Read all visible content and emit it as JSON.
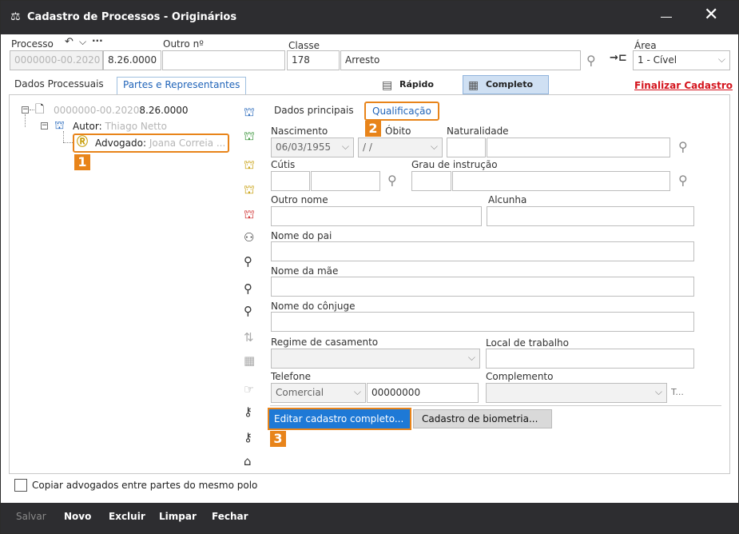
{
  "window": {
    "title": "Cadastro de Processos - Originários"
  },
  "header": {
    "processo_label": "Processo",
    "processo_num_blurred": "0000000-00.2020",
    "processo_suffix": "8.26.0000",
    "outro_label": "Outro nº",
    "outro_value": "",
    "classe_label": "Classe",
    "classe_code": "178",
    "classe_name": "Arresto",
    "area_label": "Área",
    "area_value": "1 - Cível"
  },
  "tabs": {
    "dados": "Dados Processuais",
    "partes": "Partes e Representantes"
  },
  "views": {
    "rapido": "Rápido",
    "completo": "Completo"
  },
  "finalizar": "Finalizar Cadastro",
  "tree": {
    "root_blurred": "0000000-00.2020",
    "root_suffix": "8.26.0000",
    "autor_label": "Autor:",
    "autor_name_blurred": "Thiago Netto",
    "advogado_label": "Advogado:",
    "advogado_name_blurred": "Joana Correia ..."
  },
  "subtabs": {
    "principais": "Dados principais",
    "qualificacao": "Qualificação"
  },
  "form": {
    "nascimento_label": "Nascimento",
    "nascimento_value": "06/03/1955",
    "obito_label": "Óbito",
    "obito_value": "/ /",
    "naturalidade_label": "Naturalidade",
    "cutis_label": "Cútis",
    "grau_label": "Grau de instrução",
    "outro_nome_label": "Outro nome",
    "alcunha_label": "Alcunha",
    "pai_label": "Nome do pai",
    "mae_label": "Nome da mãe",
    "conjuge_label": "Nome do cônjuge",
    "regime_label": "Regime de casamento",
    "local_label": "Local de trabalho",
    "telefone_label": "Telefone",
    "telefone_tipo": "Comercial",
    "telefone_num": "00000000",
    "complemento_label": "Complemento",
    "t_label": "T..."
  },
  "buttons": {
    "editar": "Editar cadastro completo...",
    "biometria": "Cadastro de biometria..."
  },
  "badges": {
    "b1": "1",
    "b2": "2",
    "b3": "3"
  },
  "copiar_label": "Copiar advogados entre partes do mesmo polo",
  "bottom": {
    "salvar": "Salvar",
    "novo": "Novo",
    "excluir": "Excluir",
    "limpar": "Limpar",
    "fechar": "Fechar"
  },
  "colors": {
    "accent": "#1e79d6",
    "highlight": "#e8841a",
    "danger": "#d4141d",
    "bar": "#2d2d30"
  }
}
